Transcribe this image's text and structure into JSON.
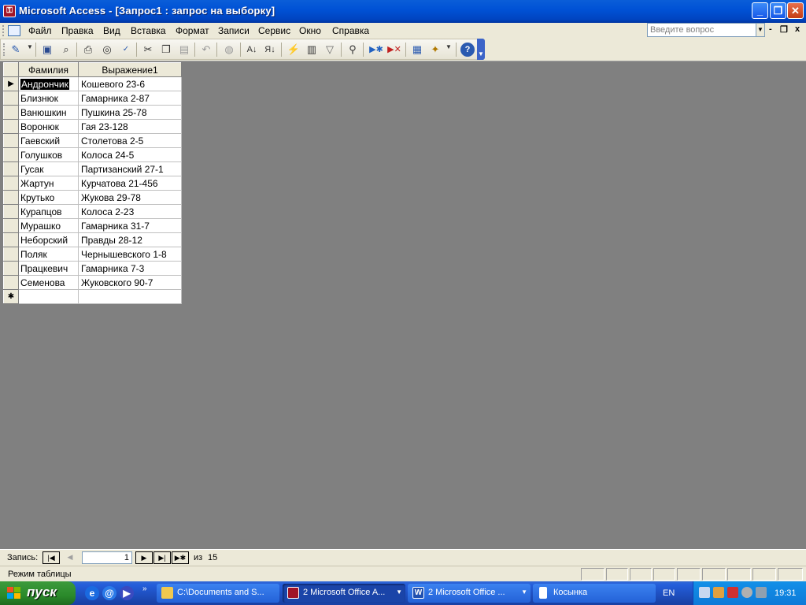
{
  "window": {
    "title": "Microsoft Access - [Запрос1 : запрос на выборку]",
    "controls": {
      "minimize": "_",
      "restore": "❐",
      "close": "✕"
    }
  },
  "menu": {
    "items": [
      "Файл",
      "Правка",
      "Вид",
      "Вставка",
      "Формат",
      "Записи",
      "Сервис",
      "Окно",
      "Справка"
    ],
    "ask_placeholder": "Введите вопрос",
    "mdi": {
      "minimize": "-",
      "restore": "❐",
      "close": "x"
    }
  },
  "toolbar": {
    "icons": [
      "view-icon",
      "save-icon",
      "search-icon",
      "print-icon",
      "print-preview-icon",
      "spelling-icon",
      "cut-icon",
      "copy-icon",
      "paste-icon",
      "undo-icon",
      "hyperlink-icon",
      "sort-ascending-icon",
      "sort-descending-icon",
      "filter-by-selection-icon",
      "filter-by-form-icon",
      "apply-filter-icon",
      "find-icon",
      "new-record-icon",
      "delete-record-icon",
      "database-window-icon",
      "new-object-icon",
      "help-icon"
    ]
  },
  "datasheet": {
    "columns": [
      "Фамилия",
      "Выражение1"
    ],
    "current_row_marker": "▶",
    "new_row_marker": "✱",
    "rows": [
      {
        "surname": "Андрончик",
        "expr": "Кошевого 23-6"
      },
      {
        "surname": "Близнюк",
        "expr": "Гамарника 2-87"
      },
      {
        "surname": "Ванюшкин",
        "expr": "Пушкина 25-78"
      },
      {
        "surname": "Воронюк",
        "expr": "Гая 23-128"
      },
      {
        "surname": "Гаевский",
        "expr": "Столетова 2-5"
      },
      {
        "surname": "Голушков",
        "expr": "Колоса 24-5"
      },
      {
        "surname": "Гусак",
        "expr": "Партизанский 27-1"
      },
      {
        "surname": "Жартун",
        "expr": "Курчатова 21-456"
      },
      {
        "surname": "Крутько",
        "expr": "Жукова 29-78"
      },
      {
        "surname": "Курапцов",
        "expr": "Колоса 2-23"
      },
      {
        "surname": "Мурашко",
        "expr": "Гамарника 31-7"
      },
      {
        "surname": "Неборский",
        "expr": "Правды 28-12"
      },
      {
        "surname": "Поляк",
        "expr": "Чернышевского 1-8"
      },
      {
        "surname": "Працкевич",
        "expr": "Гамарника 7-3"
      },
      {
        "surname": "Семенова",
        "expr": "Жуковского 90-7"
      }
    ]
  },
  "navigation": {
    "label": "Запись:",
    "current": "1",
    "of_label": "из",
    "total": "15",
    "buttons": {
      "first": "|◀",
      "prev": "◀",
      "next": "▶",
      "last": "▶|",
      "new": "▶✱"
    }
  },
  "status": {
    "mode": "Режим таблицы"
  },
  "taskbar": {
    "start_label": "пуск",
    "quick_launch": [
      "ie-icon",
      "outlook-express-icon",
      "media-player-icon"
    ],
    "overflow": "»",
    "buttons": [
      {
        "label": "C:\\Documents and S...",
        "icon": "folder-icon"
      },
      {
        "label": "2 Microsoft Office A...",
        "icon": "access-icon"
      },
      {
        "label": "2 Microsoft Office ...",
        "icon": "word-icon"
      },
      {
        "label": "Косынка",
        "icon": "solitaire-icon"
      }
    ],
    "language": "EN",
    "tray_icons": [
      "network-icon",
      "tools-icon",
      "security-icon",
      "volume-icon",
      "display-icon"
    ],
    "clock": "19:31"
  },
  "colors": {
    "titlebar": "#0052d6",
    "workspace": "#808080",
    "taskbar": "#245edb",
    "start": "#2b8a2b"
  }
}
